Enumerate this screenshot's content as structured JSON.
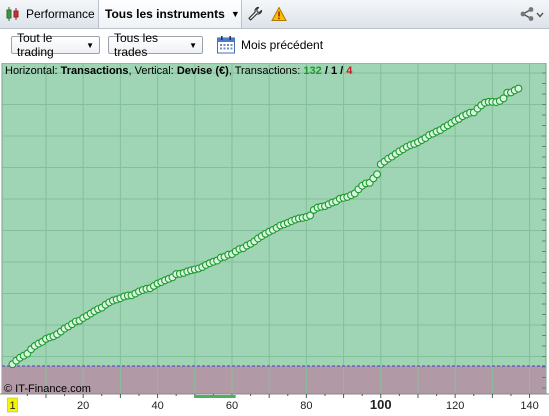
{
  "tabs": {
    "performance_label": "Performance",
    "instruments_label": "Tous les instruments"
  },
  "toolbar": {
    "trading_filter": "Tout le trading",
    "trades_filter": "Tous les trades",
    "period_label": "Mois précédent"
  },
  "chart_header": {
    "horizontal_prefix": "Horizontal:",
    "horizontal_value": "Transactions",
    "vertical_prefix": ", Vertical:",
    "vertical_value": "Devise (€)",
    "count_prefix": ", Transactions:",
    "winners": "132",
    "separator1": "/",
    "neutral": "1",
    "separator2": "/",
    "losers": "4"
  },
  "copyright": "© IT-Finance.com",
  "colors": {
    "plot_background": "#9fd4b4",
    "point_stroke": "#1c9a2c",
    "point_fill": "#d9f5e0",
    "negative_zone": "#b19aa6",
    "baseline": "#3c3cd8",
    "winners": "#1a9a2a",
    "losers": "#d01c1c"
  },
  "chart_data": {
    "type": "scatter",
    "title": "",
    "xlabel": "Transactions",
    "ylabel": "Devise (€)",
    "xlim": [
      0,
      144
    ],
    "ylim": [
      -7,
      100
    ],
    "x_ticks": [
      "1",
      "20",
      "40",
      "60",
      "80",
      "100",
      "120",
      "140"
    ],
    "grid": true,
    "x": [
      1,
      2,
      3,
      4,
      5,
      6,
      7,
      8,
      9,
      10,
      11,
      12,
      13,
      14,
      15,
      16,
      17,
      18,
      19,
      20,
      21,
      22,
      23,
      24,
      25,
      26,
      27,
      28,
      29,
      30,
      31,
      32,
      33,
      34,
      35,
      36,
      37,
      38,
      39,
      40,
      41,
      42,
      43,
      44,
      45,
      46,
      47,
      48,
      49,
      50,
      51,
      52,
      53,
      54,
      55,
      56,
      57,
      58,
      59,
      60,
      61,
      62,
      63,
      64,
      65,
      66,
      67,
      68,
      69,
      70,
      71,
      72,
      73,
      74,
      75,
      76,
      77,
      78,
      79,
      80,
      81,
      82,
      83,
      84,
      85,
      86,
      87,
      88,
      89,
      90,
      91,
      92,
      93,
      94,
      95,
      96,
      97,
      98,
      99,
      100,
      101,
      102,
      103,
      104,
      105,
      106,
      107,
      108,
      109,
      110,
      111,
      112,
      113,
      114,
      115,
      116,
      117,
      118,
      119,
      120,
      121,
      122,
      123,
      124,
      125,
      126,
      127,
      128,
      129,
      130,
      131,
      132,
      133,
      134,
      135,
      136,
      137
    ],
    "y": [
      0.6,
      1.8,
      2.8,
      3.5,
      4.2,
      5.7,
      6.8,
      7.6,
      8.2,
      9.2,
      9.7,
      10.1,
      10.8,
      11.7,
      12.7,
      13.4,
      14.2,
      15.1,
      15.4,
      16.3,
      17.0,
      17.8,
      18.6,
      19.3,
      19.8,
      20.8,
      21.6,
      22.2,
      22.6,
      23.0,
      23.6,
      23.9,
      24.0,
      24.6,
      25.3,
      25.8,
      26.2,
      26.4,
      27.2,
      28.0,
      28.5,
      29.1,
      29.6,
      30.1,
      31.2,
      31.3,
      31.6,
      32.1,
      32.5,
      32.8,
      33.1,
      33.6,
      34.3,
      34.9,
      35.4,
      35.8,
      36.8,
      37.1,
      37.8,
      38.0,
      38.9,
      39.7,
      40.0,
      40.9,
      41.5,
      42.3,
      43.3,
      44.1,
      44.9,
      45.6,
      46.2,
      46.9,
      47.7,
      48.1,
      48.6,
      49.2,
      49.7,
      50.1,
      50.3,
      50.6,
      51.1,
      53.0,
      53.8,
      54.1,
      54.3,
      54.9,
      55.5,
      55.9,
      56.8,
      57.1,
      57.4,
      58.0,
      58.6,
      60.0,
      61.2,
      62.0,
      62.2,
      63.7,
      65.1,
      68.5,
      69.4,
      70.4,
      71.1,
      72.0,
      72.9,
      73.6,
      74.4,
      75.0,
      75.4,
      76.0,
      76.7,
      77.4,
      78.4,
      78.9,
      79.6,
      80.1,
      81.0,
      81.7,
      82.5,
      83.3,
      83.9,
      84.8,
      85.4,
      86.0,
      86.1,
      87.4,
      88.5,
      89.4,
      89.7,
      89.7,
      89.6,
      90.0,
      90.9,
      92.8,
      92.9,
      93.6,
      94.2
    ]
  }
}
